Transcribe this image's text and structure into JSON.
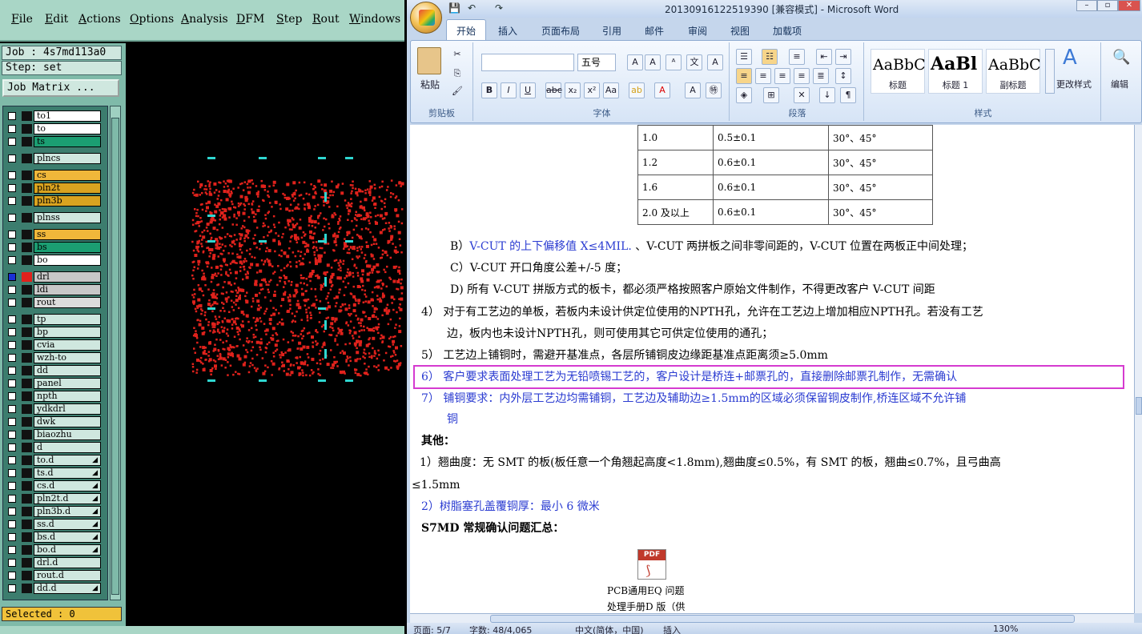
{
  "cam": {
    "menu": [
      "File",
      "Edit",
      "Actions",
      "Options",
      "Analysis",
      "DFM",
      "Step",
      "Rout",
      "Windows"
    ],
    "job_label": "Job : 4s7md113a0",
    "step_label": "Step: set",
    "job_matrix_button": "Job Matrix ...",
    "selected_label": "Selected : 0",
    "layers": [
      {
        "name": "to1",
        "color": "#ffffff"
      },
      {
        "name": "to",
        "color": "#ffffff"
      },
      {
        "name": "ts",
        "color": "#1b9e72"
      },
      {
        "name": "plncs",
        "color": "#cfe7df"
      },
      {
        "name": "cs",
        "color": "#f0b73a"
      },
      {
        "name": "pln2t",
        "color": "#d9a320"
      },
      {
        "name": "pln3b",
        "color": "#d9a320"
      },
      {
        "name": "plnss",
        "color": "#cfe7df"
      },
      {
        "name": "ss",
        "color": "#f0b73a"
      },
      {
        "name": "bs",
        "color": "#1b9e72"
      },
      {
        "name": "bo",
        "color": "#ffffff"
      },
      {
        "name": "drl",
        "color": "#c8c8c8"
      },
      {
        "name": "ldi",
        "color": "#c8c8c8"
      },
      {
        "name": "rout",
        "color": "#dcdcdc"
      },
      {
        "name": "tp",
        "color": "#cfe7df"
      },
      {
        "name": "bp",
        "color": "#cfe7df"
      },
      {
        "name": "cvia",
        "color": "#cfe7df"
      },
      {
        "name": "wzh-to",
        "color": "#cfe7df"
      },
      {
        "name": "dd",
        "color": "#cfe7df"
      },
      {
        "name": "panel",
        "color": "#cfe7df"
      },
      {
        "name": "npth",
        "color": "#cfe7df"
      },
      {
        "name": "ydkdrl",
        "color": "#cfe7df"
      },
      {
        "name": "dwk",
        "color": "#cfe7df"
      },
      {
        "name": "biaozhu",
        "color": "#cfe7df"
      },
      {
        "name": "d",
        "color": "#cfe7df"
      },
      {
        "name": "to.d",
        "color": "#cfe7df"
      },
      {
        "name": "ts.d",
        "color": "#cfe7df"
      },
      {
        "name": "cs.d",
        "color": "#cfe7df"
      },
      {
        "name": "pln2t.d",
        "color": "#cfe7df"
      },
      {
        "name": "pln3b.d",
        "color": "#cfe7df"
      },
      {
        "name": "ss.d",
        "color": "#cfe7df"
      },
      {
        "name": "bs.d",
        "color": "#cfe7df"
      },
      {
        "name": "bo.d",
        "color": "#cfe7df"
      },
      {
        "name": "drl.d",
        "color": "#cfe7df"
      },
      {
        "name": "rout.d",
        "color": "#cfe7df"
      },
      {
        "name": "dd.d",
        "color": "#cfe7df"
      }
    ],
    "colors": {
      "pcb_dots": "#e0221c",
      "fiducial": "#2fd6d0",
      "canvas": "#000000"
    }
  },
  "word": {
    "title": "20130916122519390 [兼容模式] - Microsoft Word",
    "tabs": [
      "开始",
      "插入",
      "页面布局",
      "引用",
      "邮件",
      "审阅",
      "视图",
      "加载项"
    ],
    "font_size": "五号",
    "groups": {
      "clipboard": "剪贴板",
      "font": "字体",
      "paragraph": "段落",
      "styles": "样式",
      "paste": "粘贴",
      "change_styles": "更改样式",
      "edit": "编辑"
    },
    "styles": [
      {
        "sample": "AaBbC",
        "name": "标题"
      },
      {
        "sample": "AaBl",
        "name": "标题 1"
      },
      {
        "sample": "AaBbC",
        "name": "副标题"
      }
    ],
    "table_rows": [
      [
        "1.0",
        "0.5±0.1",
        "30°、45°"
      ],
      [
        "1.2",
        "0.6±0.1",
        "30°、45°"
      ],
      [
        "1.6",
        "0.6±0.1",
        "30°、45°"
      ],
      [
        "2.0 及以上",
        "0.6±0.1",
        "30°、45°"
      ]
    ],
    "lines": [
      {
        "text": "B）V-CUT 的上下偏移值 X≤4MIL. 、V-CUT 两拼板之间非零间距的，V-CUT 位置在两板正中间处理；",
        "prefix": "B）",
        "blue": "V-CUT 的上下偏移值 X≤4MIL.",
        "rest": " 、V-CUT 两拼板之间非零间距的，V-CUT 位置在两板正中间处理；"
      },
      {
        "text": "C）V-CUT 开口角度公差+/-5 度；"
      },
      {
        "text": "D) 所有 V-CUT 拼版方式的板卡，都必须严格按照客户原始文件制作，不得更改客户 V-CUT 间距"
      },
      {
        "text": "4） 对于有工艺边的单板，若板内未设计供定位使用的NPTH孔，允许在工艺边上增加相应NPTH孔。若没有工艺"
      },
      {
        "text": "边，板内也未设计NPTH孔，则可使用其它可供定位使用的通孔；"
      },
      {
        "text": "5） 工艺边上铺铜时，需避开基准点，各层所铺铜皮边缘距基准点距离须≥5.0mm"
      },
      {
        "text": "6） 客户要求表面处理工艺为无铅喷锡工艺的，客户设计是桥连+邮票孔的，直接删除邮票孔制作，无需确认"
      },
      {
        "text": "7） 铺铜要求：内外层工艺边均需铺铜，工艺边及辅助边≥1.5mm的区域必须保留铜皮制作,桥连区域不允许铺"
      },
      {
        "text": "铜"
      },
      {
        "text": "其他："
      },
      {
        "text": "1）翘曲度：无 SMT 的板(板任意一个角翘起高度<1.8mm),翘曲度≤0.5%，有 SMT 的板，翘曲≤0.7%，且弓曲高"
      },
      {
        "text": "≤1.5mm"
      },
      {
        "text": "2）树脂塞孔盖覆铜厚：最小 6 微米"
      },
      {
        "text": "S7MD 常规确认问题汇总："
      }
    ],
    "attachment": {
      "line1": "PCB通用EQ 问题",
      "line2": "处理手册D 版（供"
    },
    "status": {
      "page": "页面: 5/7",
      "words": "字数: 48/4,065",
      "lang": "中文(简体，中国)",
      "mode": "插入",
      "zoom": "130%"
    }
  }
}
